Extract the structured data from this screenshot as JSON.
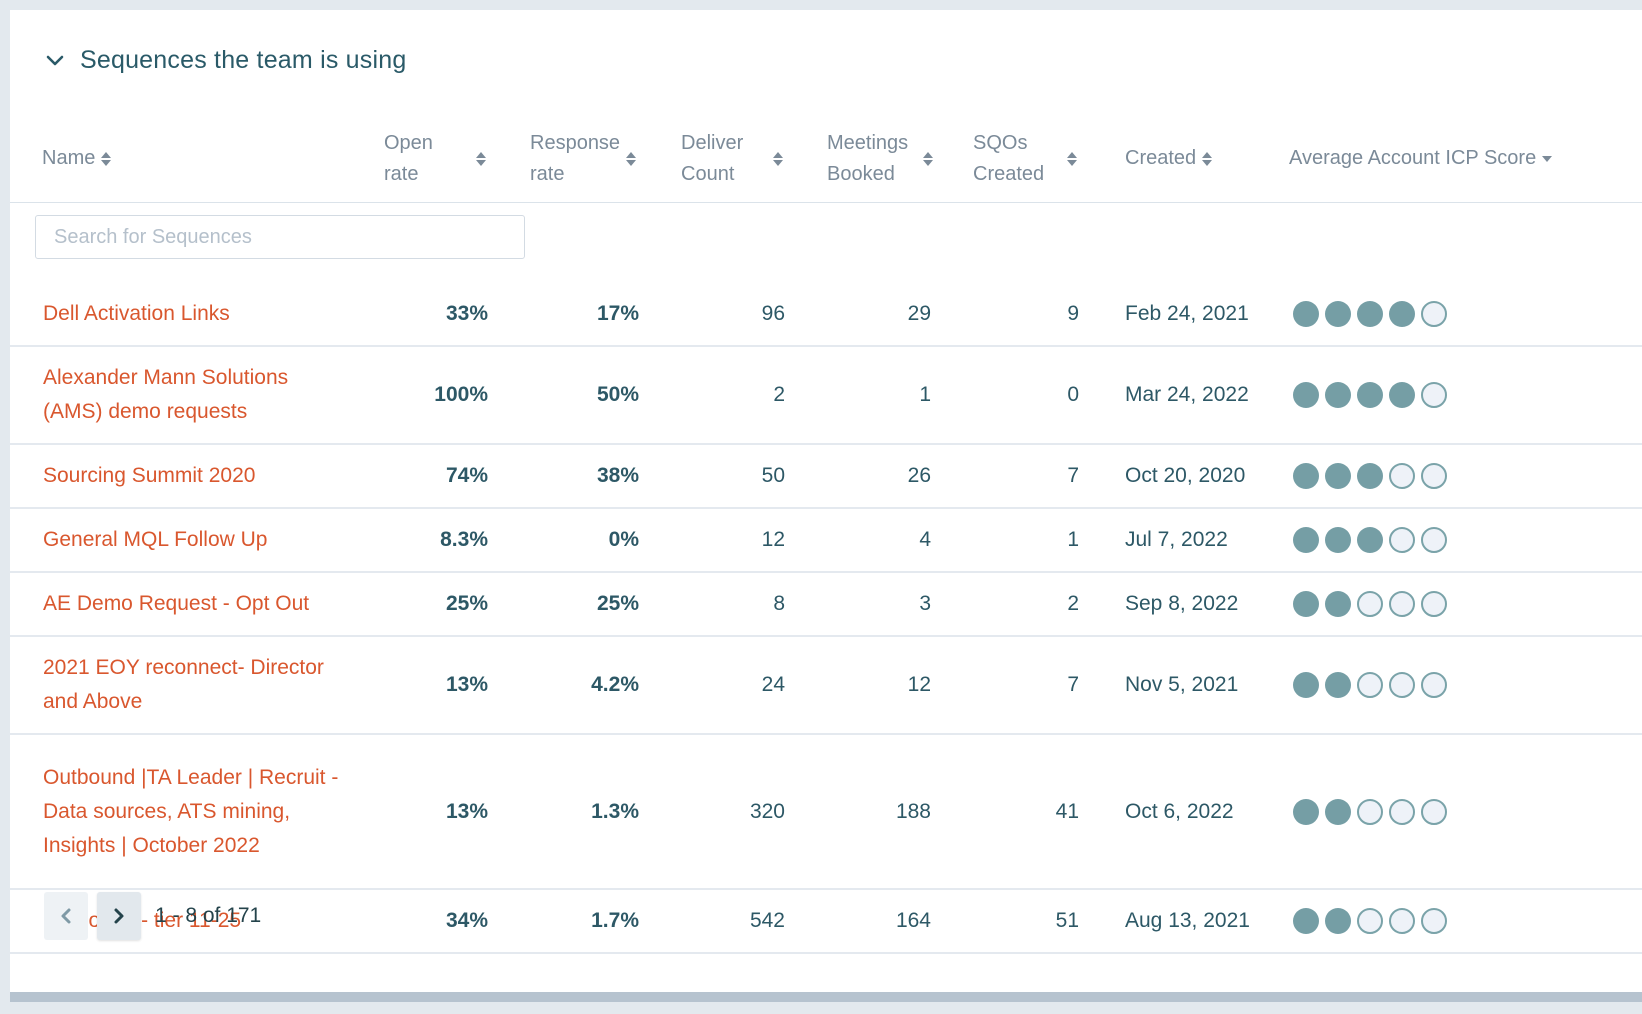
{
  "section": {
    "title": "Sequences the team is using",
    "collapse_icon": "chevron-down-icon"
  },
  "columns": [
    {
      "key": "name",
      "label": "Name",
      "sort": "sortable"
    },
    {
      "key": "open_rate",
      "label": "Open rate",
      "sort": "sortable"
    },
    {
      "key": "response_rate",
      "label": "Response rate",
      "sort": "sortable"
    },
    {
      "key": "deliver_count",
      "label": "Deliver Count",
      "sort": "sortable"
    },
    {
      "key": "meetings_booked",
      "label": "Meetings Booked",
      "sort": "sortable"
    },
    {
      "key": "sqos_created",
      "label": "SQOs Created",
      "sort": "sortable"
    },
    {
      "key": "created",
      "label": "Created",
      "sort": "sortable"
    },
    {
      "key": "icp_score",
      "label": "Average Account ICP Score",
      "sort": "descending"
    }
  ],
  "search": {
    "placeholder": "Search for Sequences",
    "value": ""
  },
  "rows": [
    {
      "name": "Dell Activation Links",
      "open_rate": "33%",
      "response_rate": "17%",
      "deliver_count": "96",
      "meetings_booked": "29",
      "sqos_created": "9",
      "created": "Feb 24, 2021",
      "icp_score": 4
    },
    {
      "name": "Alexander Mann Solutions (AMS) demo requests",
      "open_rate": "100%",
      "response_rate": "50%",
      "deliver_count": "2",
      "meetings_booked": "1",
      "sqos_created": "0",
      "created": "Mar 24, 2022",
      "icp_score": 4
    },
    {
      "name": "Sourcing Summit 2020",
      "open_rate": "74%",
      "response_rate": "38%",
      "deliver_count": "50",
      "meetings_booked": "26",
      "sqos_created": "7",
      "created": "Oct 20, 2020",
      "icp_score": 3
    },
    {
      "name": "General MQL Follow Up",
      "open_rate": "8.3%",
      "response_rate": "0%",
      "deliver_count": "12",
      "meetings_booked": "4",
      "sqos_created": "1",
      "created": "Jul 7, 2022",
      "icp_score": 3
    },
    {
      "name": "AE Demo Request - Opt Out",
      "open_rate": "25%",
      "response_rate": "25%",
      "deliver_count": "8",
      "meetings_booked": "3",
      "sqos_created": "2",
      "created": "Sep 8, 2022",
      "icp_score": 2
    },
    {
      "name": "2021 EOY reconnect- Director and Above",
      "open_rate": "13%",
      "response_rate": "4.2%",
      "deliver_count": "24",
      "meetings_booked": "12",
      "sqos_created": "7",
      "created": "Nov 5, 2021",
      "icp_score": 2
    },
    {
      "name": "Outbound |TA Leader | Recruit - Data sources, ATS mining, Insights | October 2022",
      "open_rate": "13%",
      "response_rate": "1.3%",
      "deliver_count": "320",
      "meetings_booked": "188",
      "sqos_created": "41",
      "created": "Oct 6, 2022",
      "icp_score": 2
    },
    {
      "name": "Outbound - tier 11-25",
      "open_rate": "34%",
      "response_rate": "1.7%",
      "deliver_count": "542",
      "meetings_booked": "164",
      "sqos_created": "51",
      "created": "Aug 13, 2021",
      "icp_score": 2
    }
  ],
  "icp_max": 5,
  "pagination": {
    "prev_icon": "chevron-left-icon",
    "next_icon": "chevron-right-icon",
    "range_text": "1 - 8 of 171"
  },
  "colors": {
    "link": "#d9572e",
    "title": "#2a5a68",
    "dot_filled": "#759ea5",
    "dot_empty": "#eef2f8"
  }
}
